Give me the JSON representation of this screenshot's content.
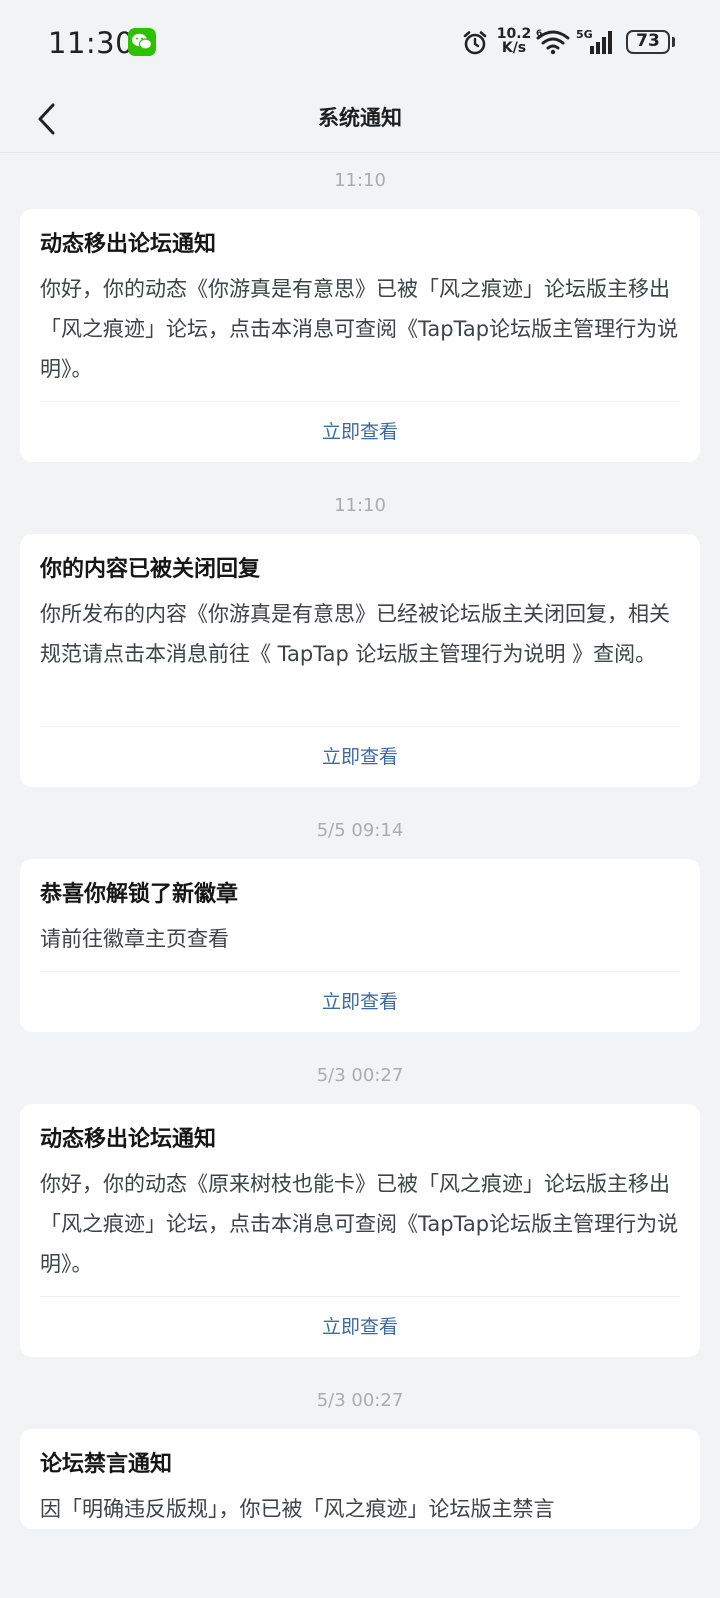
{
  "status_bar": {
    "time": "11:30",
    "net_speed_value": "10.2",
    "net_speed_unit": "K/s",
    "network_label": "5G",
    "battery_level": "73"
  },
  "nav": {
    "title": "系统通知"
  },
  "notifications": [
    {
      "time": "11:10",
      "title": "动态移出论坛通知",
      "body": "你好，你的动态《你游真是有意思》已被「风之痕迹」论坛版主移出「风之痕迹」论坛，点击本消息可查阅《TapTap论坛版主管理行为说明》。",
      "action": "立即查看"
    },
    {
      "time": "11:10",
      "title": "你的内容已被关闭回复",
      "body": "你所发布的内容《你游真是有意思》已经被论坛版主关闭回复，相关规范请点击本消息前往《 TapTap 论坛版主管理行为说明 》查阅。",
      "action": "立即查看"
    },
    {
      "time": "5/5  09:14",
      "title": "恭喜你解锁了新徽章",
      "body": "请前往徽章主页查看",
      "action": "立即查看"
    },
    {
      "time": "5/3  00:27",
      "title": "动态移出论坛通知",
      "body": "你好，你的动态《原来树枝也能卡》已被「风之痕迹」论坛版主移出「风之痕迹」论坛，点击本消息可查阅《TapTap论坛版主管理行为说明》。",
      "action": "立即查看"
    },
    {
      "time": "5/3  00:27",
      "title": "论坛禁言通知",
      "body": "因「明确违反版规」，你已被「风之痕迹」论坛版主禁言",
      "action": ""
    }
  ]
}
